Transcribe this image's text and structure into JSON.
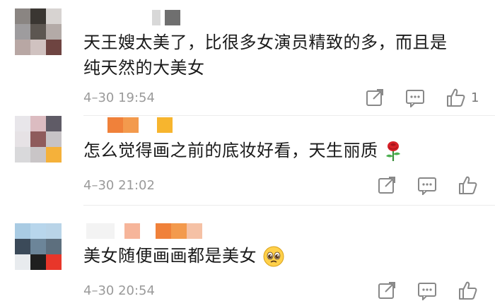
{
  "comments": [
    {
      "text_line1": "天王嫂太美了，比很多女演员精致的多，而且是",
      "text_line2": "纯天然的大美女",
      "time": "4–30 19:54",
      "likes": "1",
      "actions": [
        "share-icon",
        "comment-icon",
        "like-icon"
      ]
    },
    {
      "text": "怎么觉得画之前的底妆好看，天生丽质",
      "emoji": "rose-icon",
      "time": "4–30 21:02",
      "actions": [
        "share-icon",
        "comment-icon",
        "like-icon"
      ]
    },
    {
      "text": "美女随便画画都是美女",
      "emoji": "pleading-face-icon",
      "time": "4–30 20:54",
      "actions": [
        "share-icon",
        "comment-icon",
        "like-icon"
      ]
    }
  ],
  "colors": {
    "text": "#1a1a1a",
    "meta": "#9a9a9a",
    "icon": "#888888",
    "divider": "#ececec",
    "name_orange": "#f08a3c",
    "name_yellow": "#f7b733"
  }
}
